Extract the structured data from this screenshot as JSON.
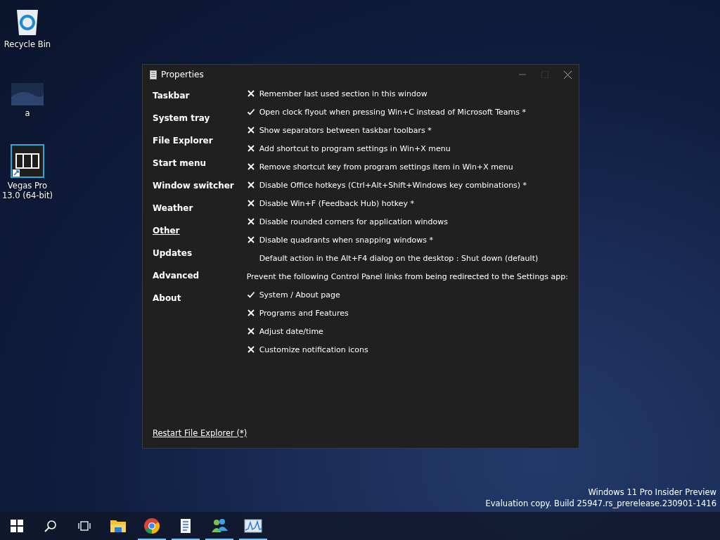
{
  "desktop_icons": [
    {
      "kind": "recycle",
      "label": "Recycle Bin"
    },
    {
      "kind": "image",
      "label": "a"
    },
    {
      "kind": "film",
      "label": "Vegas Pro 13.0 (64-bit)"
    }
  ],
  "window": {
    "title": "Properties"
  },
  "sidebar": {
    "items": [
      {
        "label": "Taskbar",
        "selected": false
      },
      {
        "label": "System tray",
        "selected": false
      },
      {
        "label": "File Explorer",
        "selected": false
      },
      {
        "label": "Start menu",
        "selected": false
      },
      {
        "label": "Window switcher",
        "selected": false
      },
      {
        "label": "Weather",
        "selected": false
      },
      {
        "label": "Other",
        "selected": true
      },
      {
        "label": "Updates",
        "selected": false
      },
      {
        "label": "Advanced",
        "selected": false
      },
      {
        "label": "About",
        "selected": false
      }
    ]
  },
  "options": [
    {
      "kind": "check",
      "label": "Remember last used section in this window",
      "checked": false
    },
    {
      "kind": "check",
      "label": "Open clock flyout when pressing Win+C instead of Microsoft Teams *",
      "checked": true
    },
    {
      "kind": "check",
      "label": "Show separators between taskbar toolbars *",
      "checked": false
    },
    {
      "kind": "check",
      "label": "Add shortcut to program settings in Win+X menu",
      "checked": false
    },
    {
      "kind": "check",
      "label": "Remove shortcut key from program settings item in Win+X menu",
      "checked": false
    },
    {
      "kind": "check",
      "label": "Disable Office hotkeys (Ctrl+Alt+Shift+Windows key combinations) *",
      "checked": false
    },
    {
      "kind": "check",
      "label": "Disable Win+F (Feedback Hub) hotkey *",
      "checked": false
    },
    {
      "kind": "check",
      "label": "Disable rounded corners for application windows",
      "checked": false
    },
    {
      "kind": "check",
      "label": "Disable quadrants when snapping windows *",
      "checked": false
    },
    {
      "kind": "choice",
      "label": "Default action in the Alt+F4 dialog on the desktop : Shut down (default)"
    },
    {
      "kind": "heading",
      "label": "Prevent the following Control Panel links from being redirected to the Settings app:"
    },
    {
      "kind": "check",
      "label": "System / About page",
      "checked": true
    },
    {
      "kind": "check",
      "label": "Programs and Features",
      "checked": false
    },
    {
      "kind": "check",
      "label": "Adjust date/time",
      "checked": false
    },
    {
      "kind": "check",
      "label": "Customize notification icons",
      "checked": false
    }
  ],
  "footer_link": "Restart File Explorer (*)",
  "watermark": [
    "Windows 11 Pro Insider Preview",
    "Evaluation copy. Build 25947.rs_prerelease.230901-1416"
  ],
  "taskbar": {
    "apps": [
      {
        "kind": "folder",
        "running": false
      },
      {
        "kind": "browser",
        "running": true
      },
      {
        "kind": "document",
        "running": true
      },
      {
        "kind": "people",
        "running": true
      },
      {
        "kind": "monitor",
        "running": true
      }
    ]
  }
}
